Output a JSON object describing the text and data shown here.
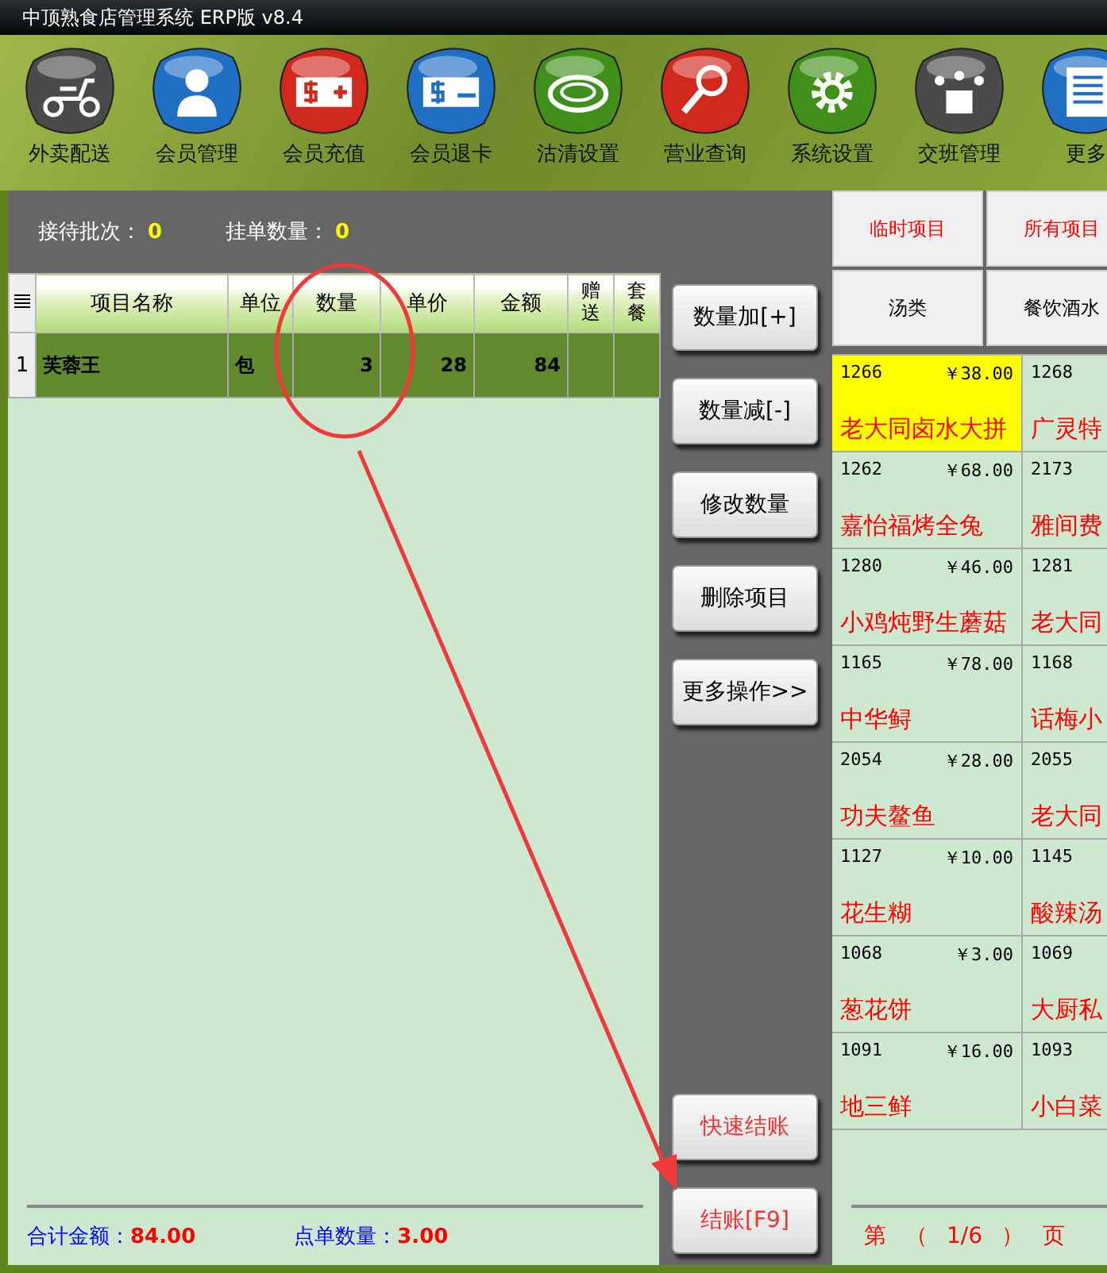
{
  "window": {
    "title": "中顶熟食店管理系统 ERP版 v8.4"
  },
  "toolbar": [
    "外卖配送",
    "会员管理",
    "会员充值",
    "会员退卡",
    "沽清设置",
    "营业查询",
    "系统设置",
    "交班管理",
    "更多"
  ],
  "status": [
    {
      "label": "接待批次：",
      "value": "0"
    },
    {
      "label": "挂单数量：",
      "value": "0"
    }
  ],
  "table": {
    "columns": [
      "项目名称",
      "单位",
      "数量",
      "单价",
      "金额",
      "赠送",
      "套餐"
    ],
    "rows": [
      {
        "index": "1",
        "name": "芙蓉王",
        "unit": "包",
        "qty": "3",
        "price": "28",
        "amount": "84",
        "selected": true
      }
    ]
  },
  "totals": [
    {
      "label": "合计金额：",
      "value": "84.00"
    },
    {
      "label": "点单数量：",
      "value": "3.00"
    }
  ],
  "action_buttons": [
    "数量加[+]",
    "数量减[-]",
    "修改数量",
    "删除项目",
    "更多操作>>"
  ],
  "checkout_buttons": [
    "快速结账",
    "结账[F9]"
  ],
  "categories": [
    {
      "label": "临时项目",
      "color": "#ff0000"
    },
    {
      "label": "所有项目",
      "color": "#ff0000"
    },
    {
      "label": "汤类",
      "color": "#000000"
    },
    {
      "label": "餐饮酒水",
      "color": "#000000"
    }
  ],
  "items": [
    {
      "code": "1266",
      "price": "￥38.00",
      "name": "老大同卤水大拼",
      "selected": true
    },
    {
      "code": "1268",
      "name": "广灵特",
      "selected": false
    },
    {
      "code": "1262",
      "price": "￥68.00",
      "name": "嘉怡福烤全兔",
      "selected": false
    },
    {
      "code": "2173",
      "name": "雅间费",
      "selected": false
    },
    {
      "code": "1280",
      "price": "￥46.00",
      "name": "小鸡炖野生蘑菇",
      "selected": false
    },
    {
      "code": "1281",
      "name": "老大同",
      "selected": false
    },
    {
      "code": "1165",
      "price": "￥78.00",
      "name": "中华鲟",
      "selected": false
    },
    {
      "code": "1168",
      "name": "话梅小",
      "selected": false
    },
    {
      "code": "2054",
      "price": "￥28.00",
      "name": "功夫鳌鱼",
      "selected": false
    },
    {
      "code": "2055",
      "name": "老大同",
      "selected": false
    },
    {
      "code": "1127",
      "price": "￥10.00",
      "name": "花生糊",
      "selected": false
    },
    {
      "code": "1145",
      "name": "酸辣汤",
      "selected": false
    },
    {
      "code": "1068",
      "price": "￥3.00",
      "name": "葱花饼",
      "selected": false
    },
    {
      "code": "1069",
      "name": "大厨私",
      "selected": false
    },
    {
      "code": "1091",
      "price": "￥16.00",
      "name": "地三鲜",
      "selected": false
    },
    {
      "code": "1093",
      "name": "小白菜",
      "selected": false
    }
  ],
  "pager": {
    "prefix": "第",
    "open": "（",
    "page": "1/6",
    "close": "）",
    "suffix": "页"
  }
}
